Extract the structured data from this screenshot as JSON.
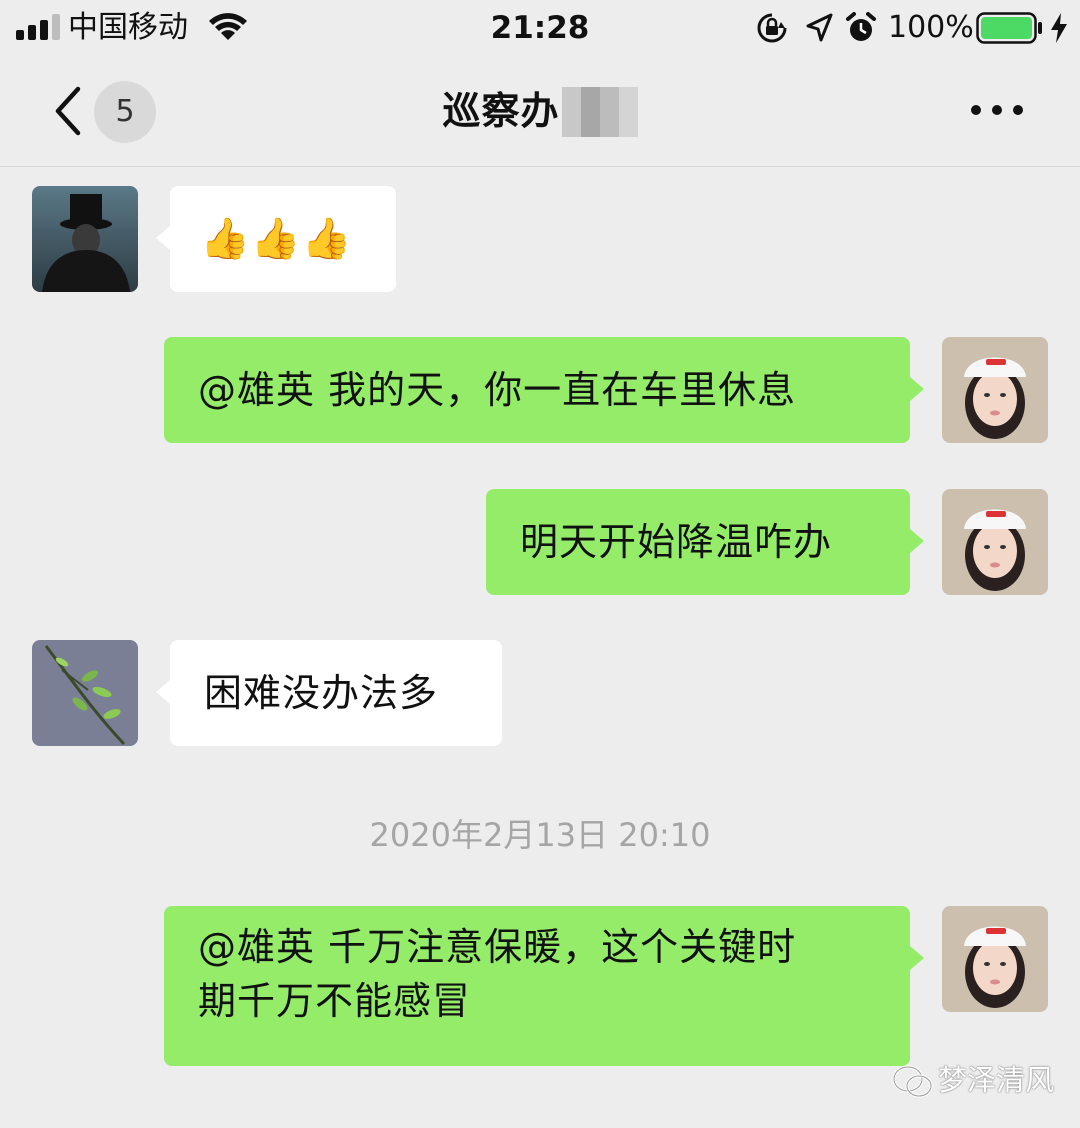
{
  "status_bar": {
    "carrier": "中国移动",
    "time": "21:28",
    "battery_percent": "100%",
    "battery_level": 1.0,
    "icons": [
      "signal-icon",
      "wifi-icon",
      "orientation-lock-icon",
      "location-icon",
      "alarm-icon",
      "battery-icon",
      "charging-icon"
    ]
  },
  "nav": {
    "unread_count": "5",
    "title": "巡察办",
    "icons": [
      "chevron-left-icon",
      "more-icon"
    ]
  },
  "messages": [
    {
      "side": "in",
      "sender": "top-hat-avatar",
      "text": "👍👍👍"
    },
    {
      "side": "out",
      "sender": "girl-avatar",
      "text": "@雄英 我的天，你一直在车里休息"
    },
    {
      "side": "out",
      "sender": "girl-avatar",
      "text": "明天开始降温咋办"
    },
    {
      "side": "in",
      "sender": "plant-avatar",
      "text": "困难没办法多"
    },
    {
      "side": "out",
      "sender": "girl-avatar",
      "lines": [
        "@雄英 千万注意保暖，这个关键时",
        "期千万不能感冒"
      ]
    }
  ],
  "timestamp": "2020年2月13日 20:10",
  "watermark": {
    "text": "梦泽清风",
    "icon": "wechat-official-icon"
  },
  "colors": {
    "background": "#ededed",
    "outgoing_bubble": "#95ec69",
    "incoming_bubble": "#ffffff",
    "battery_fill": "#4cd964"
  }
}
